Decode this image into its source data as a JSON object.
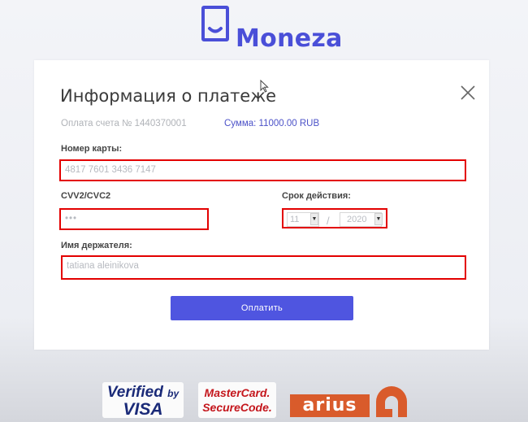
{
  "brand": {
    "name": "Moneza",
    "color": "#4a4fd8"
  },
  "dialog": {
    "title": "Информация о платеже",
    "invoice": "Оплата счета № 1440370001",
    "amount": "Сумма: 11000.00 RUB"
  },
  "form": {
    "card_number_label": "Номер карты:",
    "card_number_value": "4817 7601 3436 7147",
    "cvv_label": "CVV2/CVC2",
    "cvv_value": "•••",
    "expiry_label": "Срок действия:",
    "expiry_month": "11",
    "expiry_separator": "/",
    "expiry_year": "2020",
    "holder_label": "Имя держателя:",
    "holder_value": "tatiana aleinikova"
  },
  "pay_button": {
    "label": "Оплатить",
    "color": "#4f55e0"
  },
  "badges": {
    "visa_line1": "Verified",
    "visa_by": "by",
    "visa_line2": "VISA",
    "mastercard_line1": "MasterCard.",
    "mastercard_line2": "SecureCode.",
    "arius": "arius"
  },
  "highlight_color": "#e30000"
}
